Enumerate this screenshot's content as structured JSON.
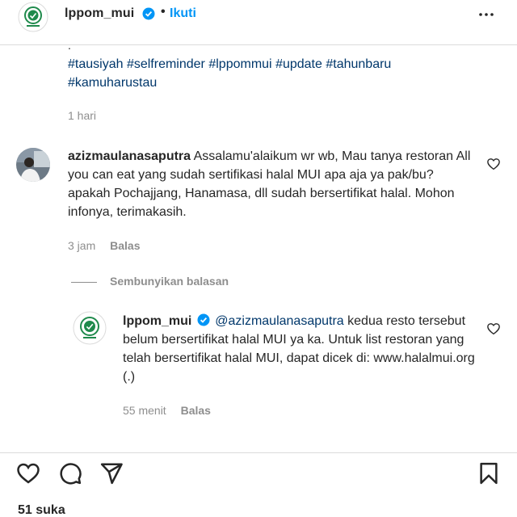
{
  "header": {
    "username": "lppom_mui",
    "separator": "•",
    "follow_label": "Ikuti",
    "more_icon": "more-horizontal-icon"
  },
  "caption": {
    "period": ".",
    "hashtags": [
      "#tausiyah",
      "#selfreminder",
      "#lppommui",
      "#update",
      "#tahunbaru",
      "#kamuharustau"
    ],
    "time": "1 hari"
  },
  "comment": {
    "username": "azizmaulanasaputra",
    "text": "Assalamu'alaikum wr wb, Mau tanya restoran All you can eat yang sudah sertifikasi halal MUI apa aja ya pak/bu? apakah Pochajjang, Hanamasa, dll sudah bersertifikat halal. Mohon infonya, terimakasih.",
    "time": "3 jam",
    "reply_label": "Balas"
  },
  "hide_replies_label": "Sembunyikan balasan",
  "reply": {
    "username": "lppom_mui",
    "mention": "@azizmaulanasaputra",
    "text": "kedua resto tersebut belum bersertifikat halal MUI ya ka. Untuk list restoran yang telah bersertifikat halal MUI, dapat dicek di: www.halalmui.org (.)",
    "time": "55 menit",
    "reply_label": "Balas"
  },
  "actions": {
    "likes": "51 suka"
  },
  "colors": {
    "link": "#00376b",
    "follow": "#0095f6",
    "verified": "#0095f6",
    "muted": "#8e8e8e",
    "brand_green": "#1f8a4c"
  }
}
